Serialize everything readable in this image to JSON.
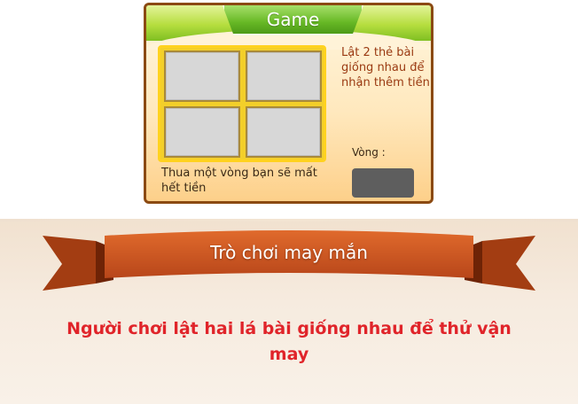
{
  "game_panel": {
    "title": "Game",
    "instruction": "Lật 2 thẻ bài giống nhau để nhận thêm tiền",
    "lose_note": "Thua một vòng bạn sẽ mất hết tiền",
    "round_label": "Vòng :",
    "cards": [
      {
        "state": "face-down"
      },
      {
        "state": "face-down"
      },
      {
        "state": "face-down"
      },
      {
        "state": "face-down"
      }
    ]
  },
  "banner": {
    "title": "Trò chơi may mắn"
  },
  "caption": "Người chơi lật hai lá bài giống nhau để thử vận may",
  "colors": {
    "ribbon": "#c8521c",
    "caption": "#e0242a",
    "panel_header": "#7fbf22",
    "card_frame": "#ffd21f"
  }
}
